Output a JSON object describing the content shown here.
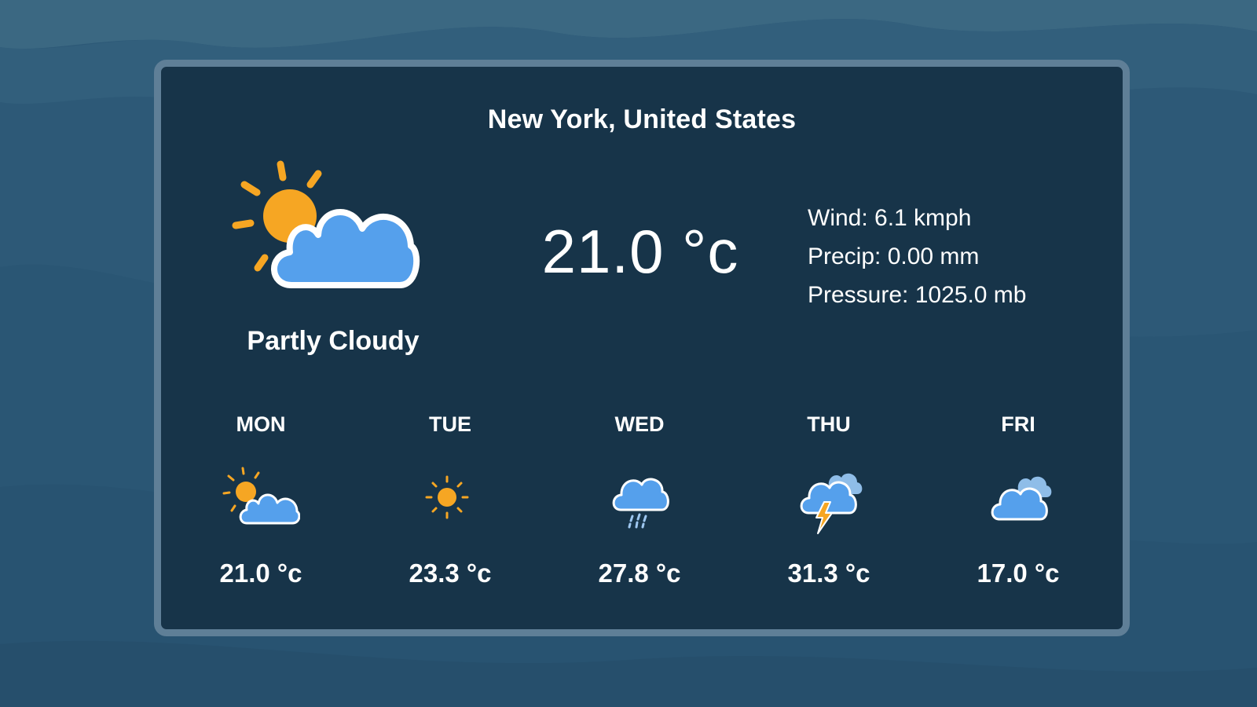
{
  "location": "New York, United States",
  "current": {
    "condition": "Partly Cloudy",
    "condition_icon": "partly-cloudy-icon",
    "temperature": "21.0 °c",
    "wind": "Wind: 6.1 kmph",
    "precip": "Precip: 0.00 mm",
    "pressure": "Pressure: 1025.0 mb"
  },
  "forecast": [
    {
      "day": "MON",
      "temp": "21.0 °c",
      "icon": "partly-cloudy-icon"
    },
    {
      "day": "TUE",
      "temp": "23.3 °c",
      "icon": "sunny-icon"
    },
    {
      "day": "WED",
      "temp": "27.8 °c",
      "icon": "rain-icon"
    },
    {
      "day": "THU",
      "temp": "31.3 °c",
      "icon": "thunderstorm-icon"
    },
    {
      "day": "FRI",
      "temp": "17.0 °c",
      "icon": "cloudy-icon"
    }
  ],
  "colors": {
    "background": "#2e5a77",
    "card": "#173449",
    "card_border": "#5f7f97",
    "sun": "#f6a623",
    "cloud": "#55a0ec"
  }
}
